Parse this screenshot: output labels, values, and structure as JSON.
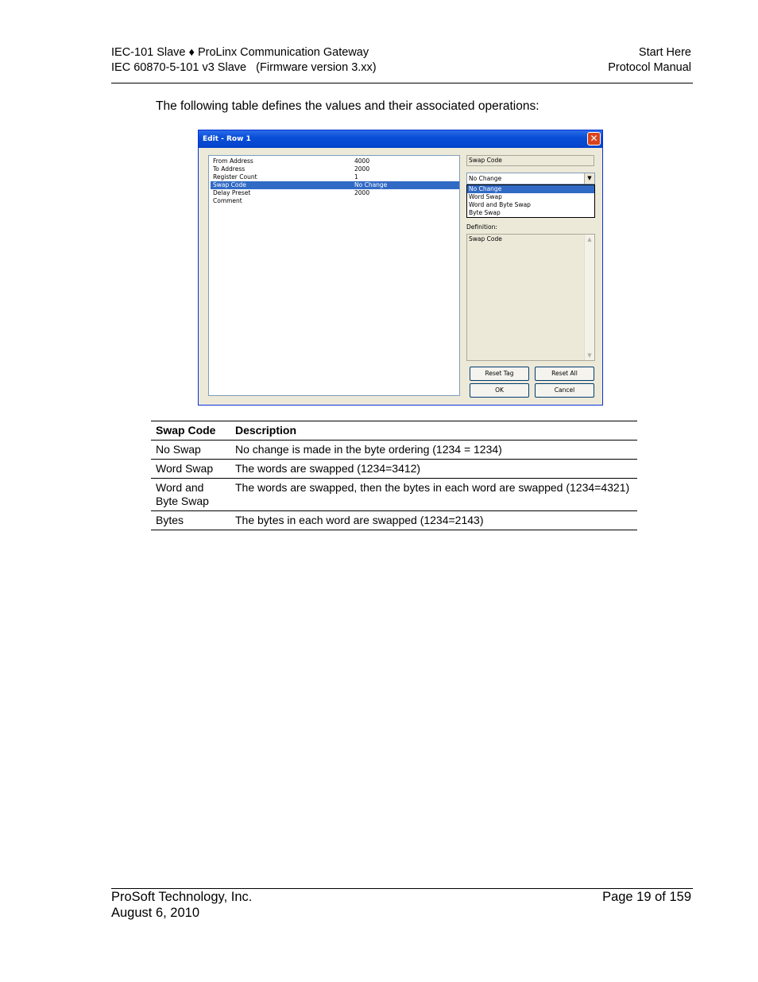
{
  "header": {
    "left_line1": "IEC-101 Slave ♦ ProLinx Communication Gateway",
    "left_line2": "IEC 60870-5-101 v3 Slave   (Firmware version 3.xx)",
    "right_line1": "Start Here",
    "right_line2": "Protocol Manual"
  },
  "intro": "The following table defines the values and their associated operations:",
  "dialog": {
    "title": "Edit - Row 1",
    "close_glyph": "✕",
    "rows": [
      {
        "key": "From Address",
        "value": "4000"
      },
      {
        "key": "To Address",
        "value": "2000"
      },
      {
        "key": "Register Count",
        "value": "1"
      },
      {
        "key": "Swap Code",
        "value": "No Change"
      },
      {
        "key": "Delay Preset",
        "value": "2000"
      },
      {
        "key": "Comment",
        "value": ""
      }
    ],
    "selected_label": "Swap Code",
    "combo_value": "No Change",
    "dropdown_options": [
      "No Change",
      "Word Swap",
      "Word and Byte Swap",
      "Byte Swap"
    ],
    "definition_label": "Definition:",
    "definition_text": "Swap Code",
    "buttons": {
      "reset_tag": "Reset Tag",
      "reset_all": "Reset All",
      "ok": "OK",
      "cancel": "Cancel"
    }
  },
  "table": {
    "headers": [
      "Swap Code",
      "Description"
    ],
    "rows": [
      [
        "No Swap",
        "No change is made in the byte ordering (1234 = 1234)"
      ],
      [
        "Word Swap",
        "The words are swapped (1234=3412)"
      ],
      [
        "Word and Byte Swap",
        "The words are swapped, then the bytes in each word are swapped (1234=4321)"
      ],
      [
        "Bytes",
        "The bytes in each word are swapped (1234=2143)"
      ]
    ]
  },
  "footer": {
    "company": "ProSoft Technology, Inc.",
    "date": "August 6, 2010",
    "page": "Page 19 of 159"
  }
}
